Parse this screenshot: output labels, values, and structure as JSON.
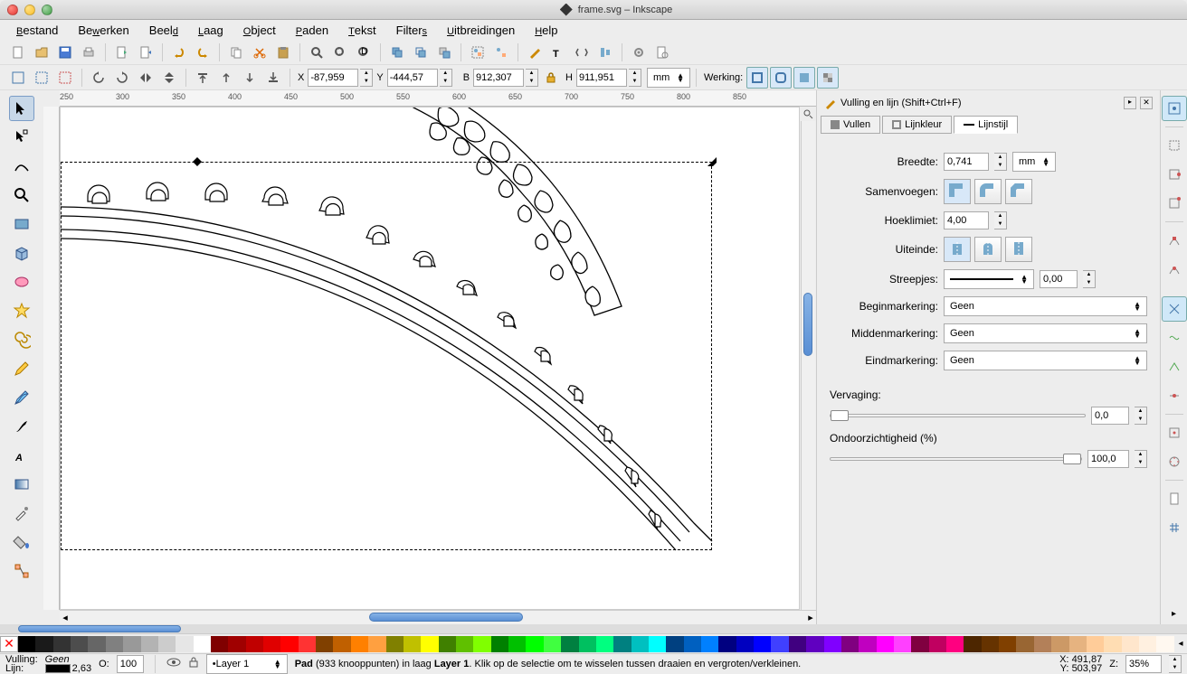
{
  "window": {
    "title": "frame.svg – Inkscape"
  },
  "menu": [
    "Bestand",
    "Bewerken",
    "Beeld",
    "Laag",
    "Object",
    "Paden",
    "Tekst",
    "Filters",
    "Uitbreidingen",
    "Help"
  ],
  "toolbar2": {
    "x_label": "X",
    "x": "-87,959",
    "y_label": "Y",
    "y": "-444,57",
    "b_label": "B",
    "b": "912,307",
    "h_label": "H",
    "h": "911,951",
    "unit": "mm",
    "werking_label": "Werking:"
  },
  "ruler_ticks": [
    "250",
    "300",
    "350",
    "400",
    "450",
    "500",
    "550",
    "600",
    "650",
    "700",
    "750",
    "800",
    "850"
  ],
  "dock": {
    "title": "Vulling en lijn (Shift+Ctrl+F)",
    "tabs": {
      "fill": "Vullen",
      "stroke": "Lijnkleur",
      "style": "Lijnstijl"
    },
    "breedte_label": "Breedte:",
    "breedte": "0,741",
    "breedte_unit": "mm",
    "samenvoegen_label": "Samenvoegen:",
    "hoeklimiet_label": "Hoeklimiet:",
    "hoeklimiet": "4,00",
    "uiteinde_label": "Uiteinde:",
    "streepjes_label": "Streepjes:",
    "streepjes_offset": "0,00",
    "begin_label": "Beginmarkering:",
    "begin_v": "Geen",
    "midden_label": "Middenmarkering:",
    "midden_v": "Geen",
    "eind_label": "Eindmarkering:",
    "eind_v": "Geen",
    "vervaging_label": "Vervaging:",
    "vervaging": "0,0",
    "ondoor_label": "Ondoorzichtigheid (%)",
    "ondoor": "100,0"
  },
  "status": {
    "vulling_label": "Vulling:",
    "vulling_val": "Geen",
    "lijn_label": "Lijn:",
    "lijn_w": "2,63",
    "o_label": "O:",
    "o_val": "100",
    "layer": "Layer 1",
    "msg_pre": "Pad",
    "msg_mid": " (933 knooppunten) in laag ",
    "msg_layer": "Layer 1",
    "msg_post": ". Klik op de selectie om te wisselen tussen draaien en vergroten/verkleinen.",
    "x_label": "X:",
    "x": "491,87",
    "y_label": "Y:",
    "y": "503,97",
    "z_label": "Z:",
    "z": "35%"
  },
  "palette": [
    "#000000",
    "#1a1a1a",
    "#333333",
    "#4d4d4d",
    "#666666",
    "#808080",
    "#999999",
    "#b3b3b3",
    "#cccccc",
    "#e6e6e6",
    "#ffffff",
    "#800000",
    "#a00000",
    "#c00000",
    "#e00000",
    "#ff0000",
    "#ff3333",
    "#804000",
    "#c06000",
    "#ff8000",
    "#ffa040",
    "#808000",
    "#c0c000",
    "#ffff00",
    "#408000",
    "#60c000",
    "#80ff00",
    "#008000",
    "#00c000",
    "#00ff00",
    "#40ff40",
    "#008040",
    "#00c060",
    "#00ff80",
    "#008080",
    "#00c0c0",
    "#00ffff",
    "#004080",
    "#0060c0",
    "#0080ff",
    "#000080",
    "#0000c0",
    "#0000ff",
    "#4040ff",
    "#400080",
    "#6000c0",
    "#8000ff",
    "#800080",
    "#c000c0",
    "#ff00ff",
    "#ff40ff",
    "#800040",
    "#c00060",
    "#ff0080",
    "#4d2600",
    "#663300",
    "#804000",
    "#996633",
    "#b38059",
    "#cc9966",
    "#e6b380",
    "#ffcc99",
    "#ffddb3",
    "#ffe6cc",
    "#fff0e0",
    "#fff8f0"
  ]
}
